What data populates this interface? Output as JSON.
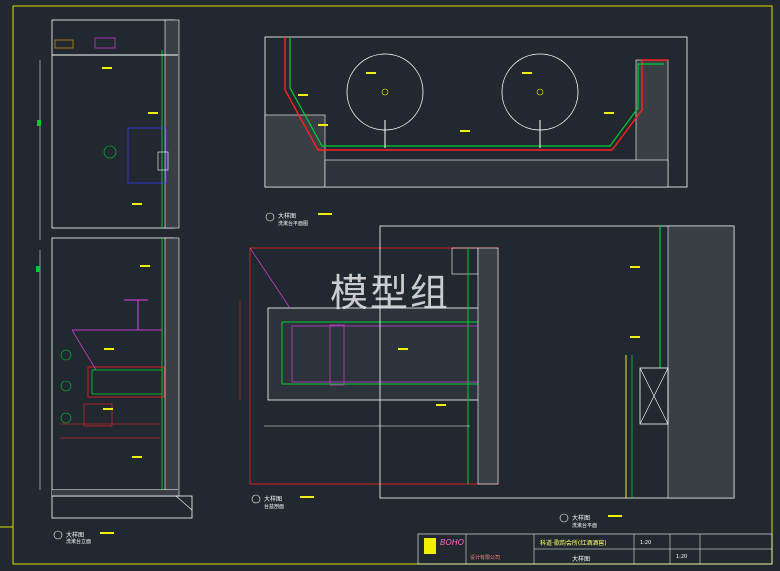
{
  "watermark": "模型组",
  "views": [
    {
      "title": "大样图",
      "subtitle": "洗漱台立面"
    },
    {
      "title": "大样图",
      "subtitle": "洗漱台平面图"
    },
    {
      "title": "大样图",
      "subtitle": "台盆剖面"
    },
    {
      "title": "大样图",
      "subtitle": "洗漱台平面"
    }
  ],
  "title_block": {
    "project": "科道·歌韵会所(红酒酒窖)",
    "drawing_name": "大样图",
    "scale": "1:20",
    "sheet_no": "1:20",
    "firm_name": "BOHO",
    "firm_subtitle": "设计有限公司"
  },
  "colors": {
    "background": "#212830",
    "frame": "#e0e000",
    "wall_line": "#ffffff",
    "green": "#00cc33",
    "red": "#ff2020",
    "magenta": "#c03cc8",
    "blue": "#3a3aff",
    "yellow": "#f0f000"
  }
}
